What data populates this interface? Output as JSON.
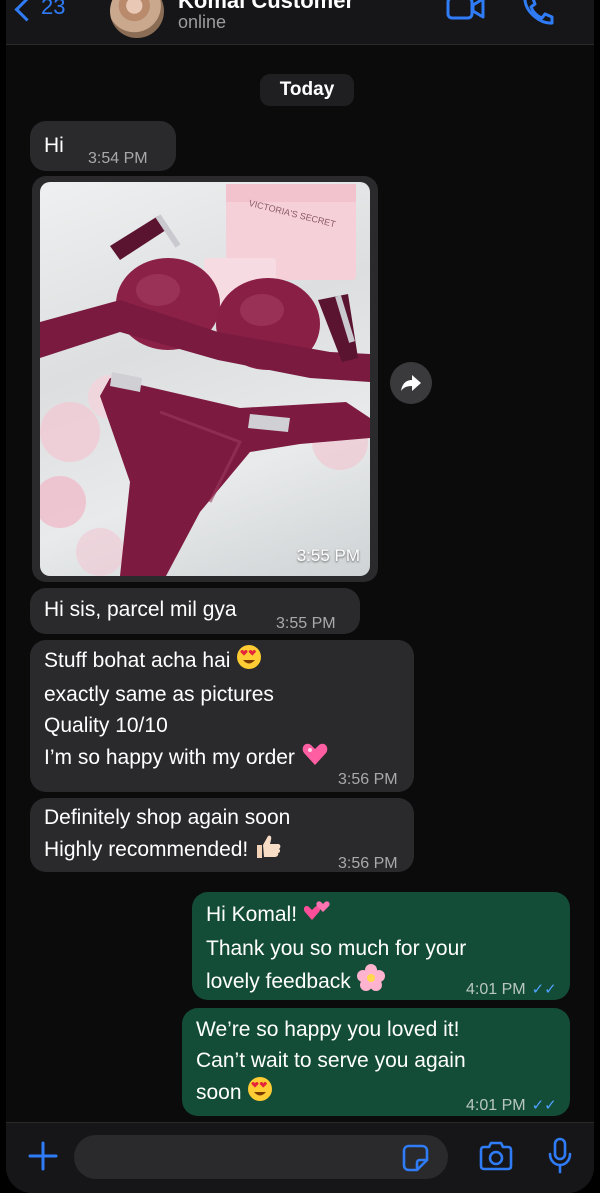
{
  "header": {
    "back_count": "23",
    "contact_name": "Komal Customer",
    "status": "online"
  },
  "date_label": "Today",
  "messages": [
    {
      "dir": "in",
      "lines": [
        "Hi"
      ],
      "time": "3:54 PM"
    },
    {
      "dir": "in",
      "type": "image",
      "time": "3:55 PM",
      "image_text": "VICTORIA'S SECRET"
    },
    {
      "dir": "in",
      "lines": [
        "Hi sis, parcel mil gya"
      ],
      "time": "3:55 PM"
    },
    {
      "dir": "in",
      "lines": [
        "Stuff bohat acha hai",
        "exactly same as pictures",
        "Quality 10/10",
        "I’m so happy with my order"
      ],
      "time": "3:56 PM"
    },
    {
      "dir": "in",
      "lines": [
        "Definitely shop again soon",
        "Highly recommended!"
      ],
      "time": "3:56 PM"
    },
    {
      "dir": "out",
      "lines": [
        "Hi Komal!",
        "Thank you so much for your",
        "lovely feedback"
      ],
      "time": "4:01 PM",
      "read": "✓✓"
    },
    {
      "dir": "out",
      "lines": [
        "We’re so happy you loved it!",
        "Can’t wait to serve you again",
        "soon"
      ],
      "time": "4:01 PM",
      "read": "✓✓"
    }
  ],
  "colors": {
    "accent": "#2f7cf6",
    "incoming_bubble": "#2a2a2c",
    "outgoing_bubble": "#144d37",
    "background": "#0b0b0c"
  },
  "icons": [
    "back-chevron-icon",
    "video-call-icon",
    "phone-call-icon",
    "forward-icon",
    "plus-icon",
    "sticker-icon",
    "camera-icon",
    "microphone-icon"
  ]
}
